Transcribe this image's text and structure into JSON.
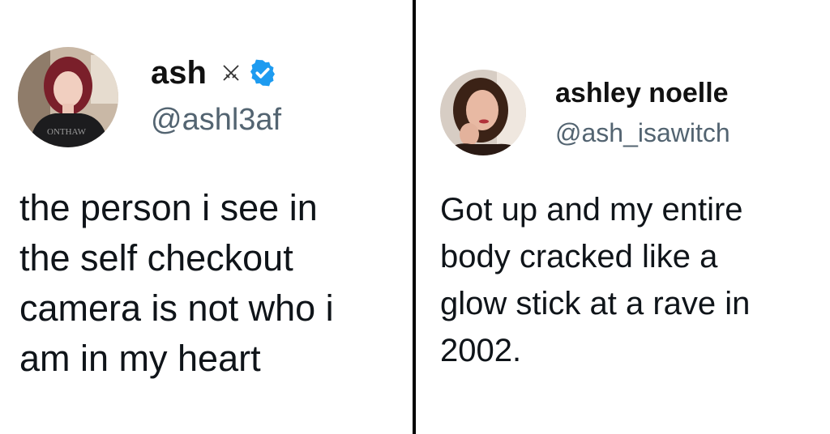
{
  "left_tweet": {
    "display_name": "ash",
    "handle": "@ashl3af",
    "name_icons": [
      "crossed-swords-icon",
      "verified-badge-icon"
    ],
    "verified_color": "#1d9bf0",
    "avatar_shirt_text": "ONTHAW",
    "text_lines": [
      "the person i see in",
      "the self checkout",
      "camera is not who i",
      "am in my heart"
    ]
  },
  "right_tweet": {
    "display_name": "ashley noelle",
    "handle": "@ash_isawitch",
    "text_lines": [
      "Got up and my entire",
      "body cracked like a",
      "glow stick at a rave in",
      "2002."
    ]
  },
  "colors": {
    "handle": "#536471",
    "text": "#0f1419",
    "divider": "#000000"
  }
}
